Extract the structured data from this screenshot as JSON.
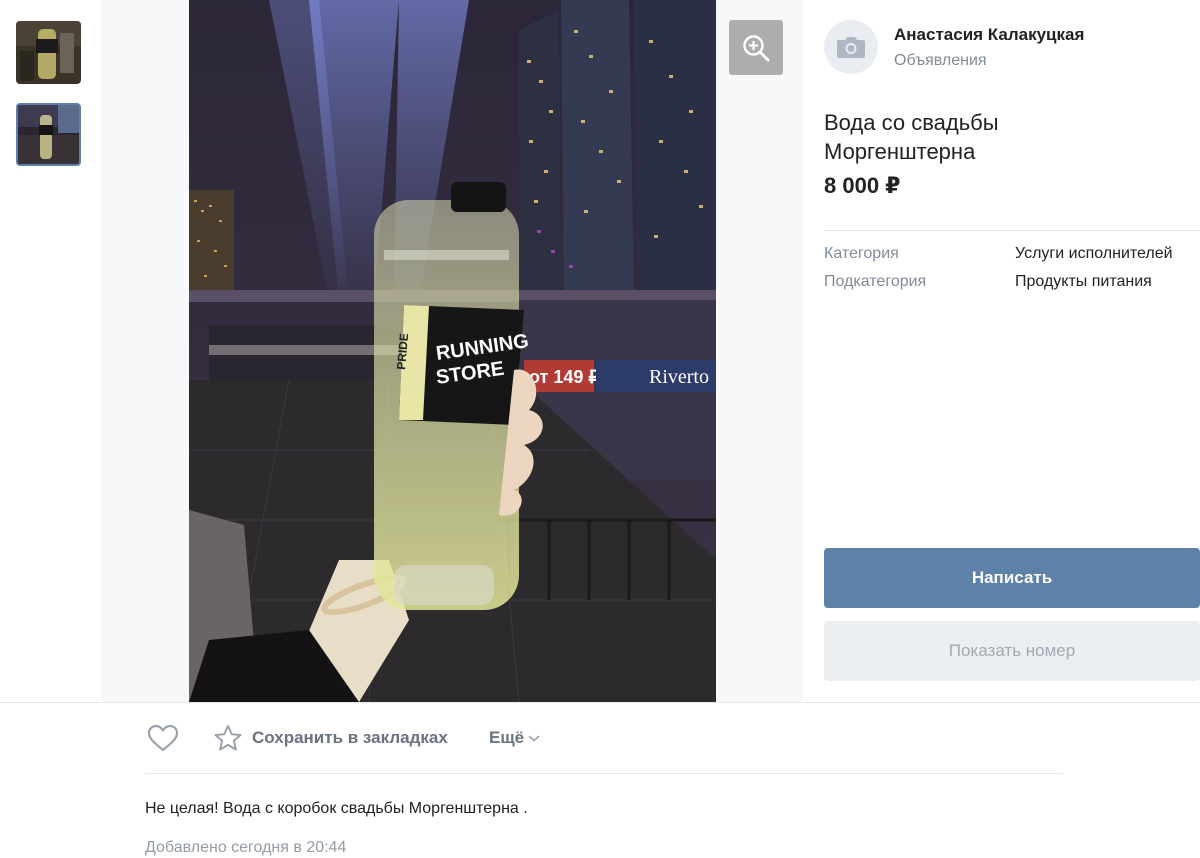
{
  "gallery": {
    "thumbnails": [
      {
        "alt": "thumbnail-1",
        "selected": false
      },
      {
        "alt": "thumbnail-2",
        "selected": true
      }
    ],
    "zoom_icon": "zoom-in-icon"
  },
  "seller": {
    "name": "Анастасия Калакуцкая",
    "section": "Объявления",
    "avatar_icon": "camera-icon"
  },
  "listing": {
    "title": "Вода со свадьбы Моргенштерна",
    "price": "8 000 ₽",
    "properties": [
      {
        "label": "Категория",
        "value": "Услуги исполнителей"
      },
      {
        "label": "Подкатегория",
        "value": "Продукты питания"
      }
    ],
    "description": "Не целая! Вода с коробок свадьбы Моргенштерна .",
    "added": "Добавлено сегодня в 20:44"
  },
  "buttons": {
    "write": "Написать",
    "show_phone": "Показать номер"
  },
  "actions": {
    "like_icon": "heart-icon",
    "bookmark_icon": "star-icon",
    "bookmark_label": "Сохранить в закладках",
    "more_label": "Ещё",
    "more_icon": "chevron-down-icon"
  },
  "photo": {
    "bottle_label_line1": "RUNNING",
    "bottle_label_line2": "STORE",
    "bottle_label_side": "PRIDE",
    "sign_price": "от 149 ₽",
    "sign_name": "Riverto"
  },
  "colors": {
    "accent": "#5e81a8",
    "muted_text": "#818c99",
    "secondary_button": "#eceff2"
  }
}
